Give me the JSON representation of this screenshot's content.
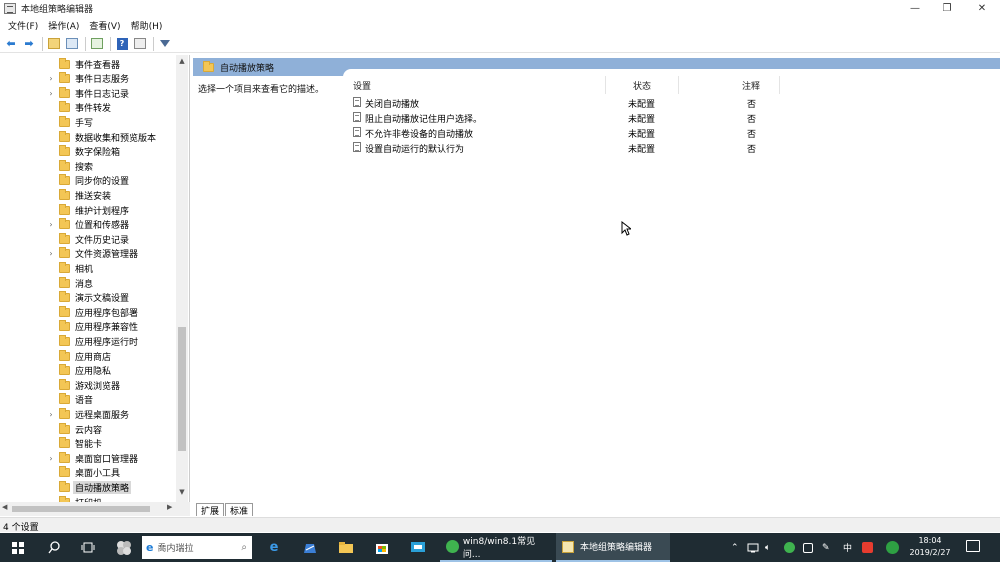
{
  "window": {
    "title": "本地组策略编辑器",
    "min": "—",
    "max": "❐",
    "close": "✕"
  },
  "menu": [
    "文件(F)",
    "操作(A)",
    "查看(V)",
    "帮助(H)"
  ],
  "tree": {
    "items": [
      {
        "label": "事件查看器",
        "expandable": false
      },
      {
        "label": "事件日志服务",
        "expandable": true
      },
      {
        "label": "事件日志记录",
        "expandable": true
      },
      {
        "label": "事件转发",
        "expandable": false
      },
      {
        "label": "手写",
        "expandable": false
      },
      {
        "label": "数据收集和预览版本",
        "expandable": false
      },
      {
        "label": "数字保险箱",
        "expandable": false
      },
      {
        "label": "搜索",
        "expandable": false
      },
      {
        "label": "同步你的设置",
        "expandable": false
      },
      {
        "label": "推送安装",
        "expandable": false
      },
      {
        "label": "维护计划程序",
        "expandable": false
      },
      {
        "label": "位置和传感器",
        "expandable": true
      },
      {
        "label": "文件历史记录",
        "expandable": false
      },
      {
        "label": "文件资源管理器",
        "expandable": true
      },
      {
        "label": "相机",
        "expandable": false
      },
      {
        "label": "消息",
        "expandable": false
      },
      {
        "label": "演示文稿设置",
        "expandable": false
      },
      {
        "label": "应用程序包部署",
        "expandable": false
      },
      {
        "label": "应用程序兼容性",
        "expandable": false
      },
      {
        "label": "应用程序运行时",
        "expandable": false
      },
      {
        "label": "应用商店",
        "expandable": false
      },
      {
        "label": "应用隐私",
        "expandable": false
      },
      {
        "label": "游戏浏览器",
        "expandable": false
      },
      {
        "label": "语音",
        "expandable": false
      },
      {
        "label": "远程桌面服务",
        "expandable": true
      },
      {
        "label": "云内容",
        "expandable": false
      },
      {
        "label": "智能卡",
        "expandable": false
      },
      {
        "label": "桌面窗口管理器",
        "expandable": true
      },
      {
        "label": "桌面小工具",
        "expandable": false
      },
      {
        "label": "自动播放策略",
        "expandable": false,
        "selected": true
      },
      {
        "label": "打印机",
        "expandable": false
      }
    ]
  },
  "pane": {
    "header": "自动播放策略",
    "description": "选择一个项目来查看它的描述。",
    "columns": {
      "setting": "设置",
      "state": "状态",
      "comment": "注释"
    },
    "rows": [
      {
        "setting": "关闭自动播放",
        "state": "未配置",
        "comment": "否"
      },
      {
        "setting": "阻止自动播放记住用户选择。",
        "state": "未配置",
        "comment": "否"
      },
      {
        "setting": "不允许非卷设备的自动播放",
        "state": "未配置",
        "comment": "否"
      },
      {
        "setting": "设置自动运行的默认行为",
        "state": "未配置",
        "comment": "否"
      }
    ]
  },
  "tabs": [
    "扩展",
    "标准"
  ],
  "status": "4 个设置",
  "taskbar": {
    "search_text": "喬内瑞拉",
    "tasks": [
      {
        "label": "win8/win8.1常见问..."
      },
      {
        "label": "本地组策略编辑器"
      }
    ],
    "ime": "中",
    "time": "18:04",
    "date": "2019/2/27"
  }
}
